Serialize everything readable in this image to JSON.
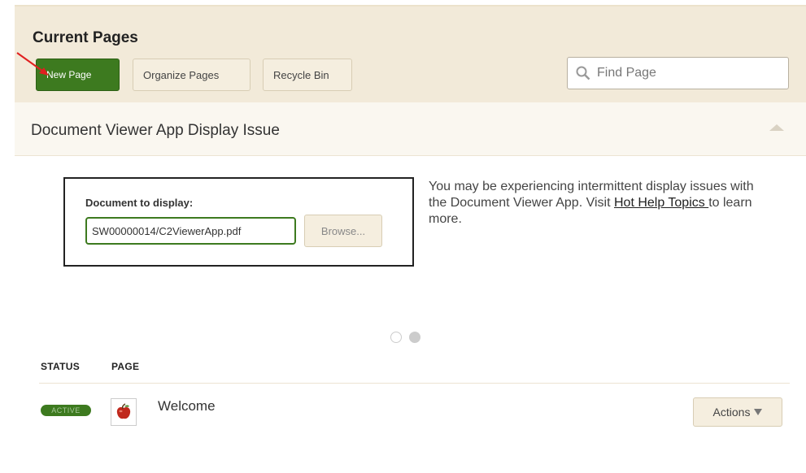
{
  "header": {
    "title": "Current Pages",
    "buttons": {
      "new_page": "New Page",
      "organize_pages": "Organize Pages",
      "recycle_bin": "Recycle Bin"
    },
    "search": {
      "placeholder": "Find Page"
    }
  },
  "notice_panel": {
    "title": "Document Viewer App Display Issue",
    "document_box": {
      "label": "Document to display:",
      "value": "SW00000014/C2ViewerApp.pdf",
      "browse_label": "Browse..."
    },
    "message_before_link": "You may be experiencing intermittent display issues with the Document Viewer App. Visit ",
    "link_text": "Hot Help Topics ",
    "message_after_link": "to learn more.",
    "carousel_pages": 2,
    "carousel_active": 2
  },
  "table": {
    "headers": {
      "status": "STATUS",
      "page": "PAGE"
    },
    "rows": [
      {
        "status": "ACTIVE",
        "page": "Welcome",
        "actions_label": "Actions"
      }
    ]
  },
  "colors": {
    "accent_green": "#3d7a1f",
    "background": "#f2ead9",
    "annotation_arrow": "#e02020"
  },
  "icons": [
    "search-icon",
    "collapse-icon",
    "apple-icon",
    "caret-down-icon",
    "annotation-arrow"
  ]
}
